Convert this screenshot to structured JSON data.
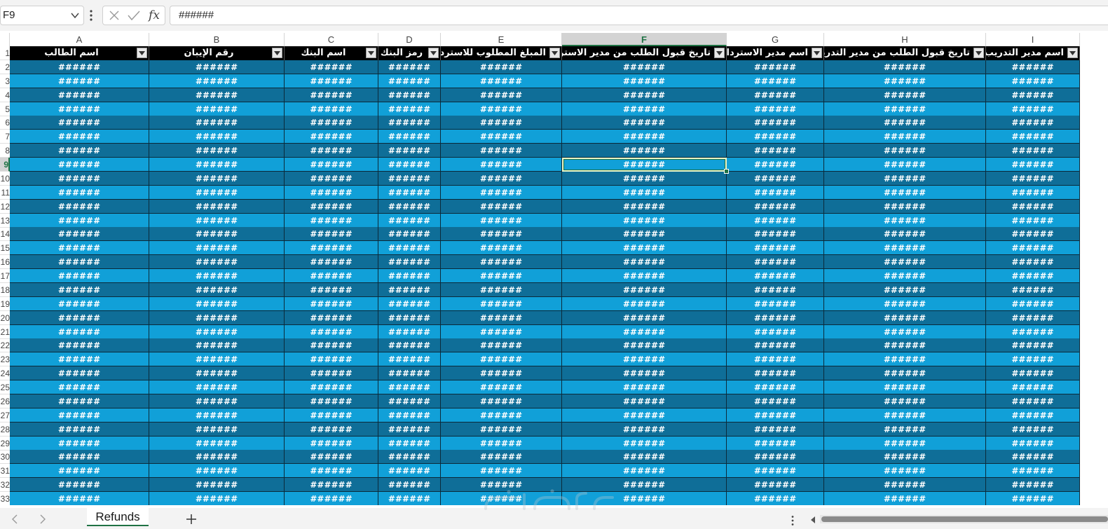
{
  "formula_bar": {
    "name_box": "F9",
    "formula": "######"
  },
  "columns": [
    "A",
    "B",
    "C",
    "D",
    "E",
    "F",
    "G",
    "H",
    "I"
  ],
  "selected_column": "F",
  "table_headers": [
    "اسم الطالب",
    "رقم الإيبان",
    "اسم البنك",
    "رمز البنك",
    "المبلغ المطلوب للاسترداد",
    "تاريخ قبول الطلب من مدير الاسترداد",
    "اسم مدير الاسترداد",
    "تاريخ قبول الطلب من مدير التدريب",
    "اسم مدير التدريب"
  ],
  "row_numbers": [
    "1",
    "2",
    "3",
    "4",
    "5",
    "6",
    "7",
    "8",
    "9",
    "10",
    "11",
    "12",
    "13",
    "14",
    "15",
    "16",
    "17",
    "18",
    "19",
    "20",
    "21",
    "22",
    "23",
    "24",
    "25",
    "26",
    "27",
    "28",
    "29",
    "30",
    "31",
    "32",
    "33"
  ],
  "selected_row": "9",
  "cell_value": "######",
  "sheet_bar": {
    "active_tab": "Refunds"
  },
  "colors": {
    "header_bg": "#000000",
    "row_dark": "#0f6e98",
    "row_light": "#11a0d8",
    "excel_green": "#1f7244"
  },
  "icons": {
    "chevron": "chevron-down-icon",
    "cancel": "x-icon",
    "enter": "checkmark-icon",
    "function": "fx-icon",
    "filter": "filter-dropdown-icon",
    "prev": "chevron-left-icon",
    "next": "chevron-right-icon",
    "add": "plus-icon"
  }
}
